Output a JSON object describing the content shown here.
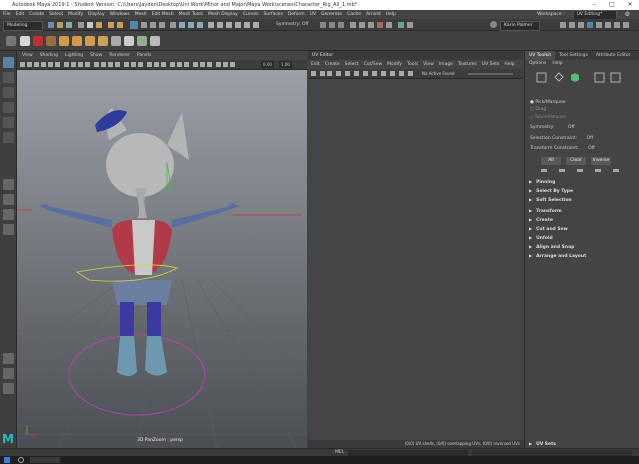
{
  "window": {
    "title": "Autodesk Maya 2019.1 - Student Version: C:\\Users\\Jayden\\Desktop\\Uni Work\\Minor and Major\\Maya Work\\scenes\\Character_Rig_All_1.mb*",
    "controls": [
      "–",
      "□",
      "✕"
    ]
  },
  "menubar": {
    "items": [
      "File",
      "Edit",
      "Create",
      "Select",
      "Modify",
      "Display",
      "Windows",
      "Mesh",
      "Edit Mesh",
      "Mesh Tools",
      "Mesh Display",
      "Curves",
      "Surfaces",
      "Deform",
      "UV",
      "Generate",
      "Cache",
      "Arnold",
      "Help"
    ],
    "workspace_label": "Workspace :",
    "workspace_value": "UV Editing*"
  },
  "statusline": {
    "mode": "Modeling",
    "symmetry": "Symmetry: Off",
    "user": "Karin Palmer"
  },
  "viewport": {
    "menu": [
      "View",
      "Shading",
      "Lighting",
      "Show",
      "Renderer",
      "Panels"
    ],
    "field_a": "0.00",
    "field_b": "1.00",
    "camera_label": "3D PanZoom : persp"
  },
  "uv_editor": {
    "title": "UV Editor",
    "menu": [
      "Edit",
      "Create",
      "Select",
      "Cut/Sew",
      "Modify",
      "Tools",
      "View",
      "Image",
      "Textures",
      "UV Sets",
      "Help"
    ],
    "texture_dropdown": "No Active Found",
    "status": "(0/0) UV shells, (0/0) overlapping UVs, (0/0) reversed UVs"
  },
  "right_panel": {
    "tabs": [
      "UV Toolkit",
      "Tool Settings",
      "Attribute Editor"
    ],
    "menu": [
      "Options",
      "Help"
    ],
    "pick_options": [
      "Pick/Marquee",
      "Drag",
      "Tweak/Marquee"
    ],
    "symmetry_label": "Symmetry:",
    "symmetry_value": "Off",
    "selection_constraint_label": "Selection Constraint:",
    "selection_constraint_value": "Off",
    "transform_constraint_label": "Transform Constraint:",
    "transform_constraint_value": "Off",
    "buttons": [
      "All",
      "Clear",
      "Inverse"
    ],
    "sections": [
      "Pinning",
      "Select By Type",
      "Soft Selection",
      "Transform",
      "Create",
      "Cut and Sew",
      "Unfold",
      "Align and Snap",
      "Arrange and Layout"
    ],
    "bottom_section": "UV Sets"
  },
  "bottom": {
    "mel_label": "MEL"
  },
  "colors": {
    "accent_blue": "#5285a6",
    "bg": "#444444",
    "viewport_top": "#9aa0a6",
    "viewport_bottom": "#4b4e52"
  },
  "icons": [
    "select-tool-icon",
    "lasso-icon",
    "paint-select-icon",
    "move-icon",
    "rotate-icon",
    "scale-icon",
    "maya-logo-icon"
  ]
}
